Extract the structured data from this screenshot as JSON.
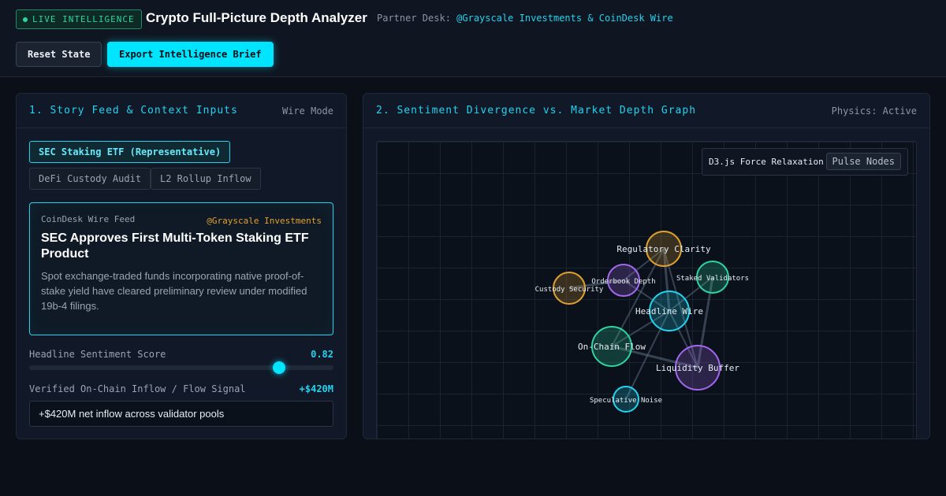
{
  "header": {
    "live_badge": "LIVE INTELLIGENCE",
    "title": "Crypto Full-Picture Depth Analyzer",
    "partner_prefix": "Partner Desk:",
    "partner_names": "@Grayscale Investments & CoinDesk Wire",
    "reset_label": "Reset State",
    "export_label": "Export Intelligence Brief"
  },
  "left_panel": {
    "title": "1. Story Feed & Context Inputs",
    "mode": "Wire Mode",
    "chips": [
      {
        "label": "SEC Staking ETF (Representative)",
        "active": true
      },
      {
        "label": "DeFi Custody Audit",
        "active": false
      },
      {
        "label": "L2 Rollup Inflow",
        "active": false
      }
    ],
    "story": {
      "source": "CoinDesk Wire Feed",
      "partner": "@Grayscale Investments",
      "headline": "SEC Approves First Multi-Token Staking ETF Product",
      "body": "Spot exchange-traded funds incorporating native proof-of-stake yield have cleared preliminary review under modified 19b-4 filings."
    },
    "sentiment": {
      "label": "Headline Sentiment Score",
      "value": "0.82",
      "fraction": 0.82
    },
    "flow": {
      "label": "Verified On-Chain Inflow / Flow Signal",
      "value": "+$420M",
      "input_value": "+$420M net inflow across validator pools"
    }
  },
  "right_panel": {
    "title": "2. Sentiment Divergence vs. Market Depth Graph",
    "physics": "Physics: Active",
    "control_label": "D3.js Force Relaxation",
    "pulse_label": "Pulse Nodes",
    "nodes": [
      {
        "id": "regulatory",
        "label": "Regulatory Clarity",
        "color": "#e0a030",
        "size": "medium"
      },
      {
        "id": "orderbook",
        "label": "Orderbook Depth",
        "color": "#a367f0",
        "size": "small"
      },
      {
        "id": "custody",
        "label": "Custody Security",
        "color": "#e0a030",
        "size": "small"
      },
      {
        "id": "staked",
        "label": "Staked Validators",
        "color": "#2dd4a0",
        "size": "small"
      },
      {
        "id": "headline",
        "label": "Headline Wire",
        "color": "#22d3ee",
        "size": "large"
      },
      {
        "id": "onchain",
        "label": "On-Chain Flow",
        "color": "#2dd4a0",
        "size": "large"
      },
      {
        "id": "liquidity",
        "label": "Liquidity Buffer",
        "color": "#a367f0",
        "size": "xlarge"
      },
      {
        "id": "speculative",
        "label": "Speculative Noise",
        "color": "#22d3ee",
        "size": "tiny"
      }
    ],
    "edges": [
      [
        "regulatory",
        "headline"
      ],
      [
        "regulatory",
        "liquidity"
      ],
      [
        "regulatory",
        "orderbook"
      ],
      [
        "custody",
        "orderbook"
      ],
      [
        "orderbook",
        "headline"
      ],
      [
        "staked",
        "headline"
      ],
      [
        "staked",
        "liquidity"
      ],
      [
        "headline",
        "onchain"
      ],
      [
        "headline",
        "liquidity"
      ],
      [
        "onchain",
        "liquidity"
      ],
      [
        "speculative",
        "headline"
      ],
      [
        "onchain",
        "regulatory"
      ]
    ]
  }
}
